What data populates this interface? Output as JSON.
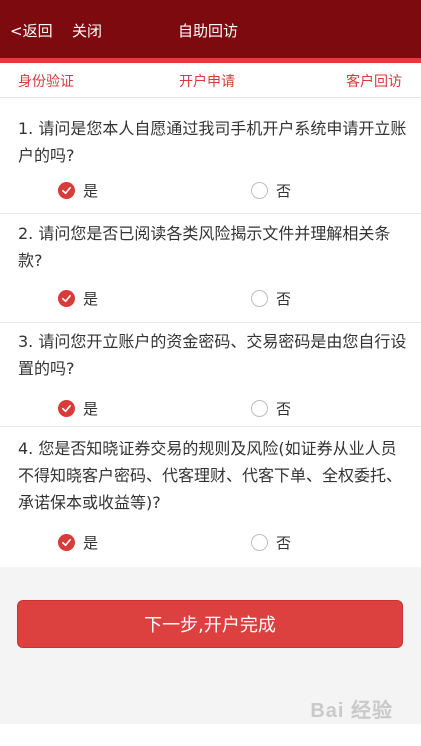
{
  "header": {
    "back_label": "<返回",
    "close_label": "关闭",
    "title": "自助回访",
    "bar_color": "#7d0a0f",
    "accent_line_color": "#e8373d"
  },
  "steps": {
    "items": [
      "身份验证",
      "开户申请",
      "客户回访"
    ]
  },
  "questions": [
    {
      "text": "1. 请问是您本人自愿通过我司手机开户系统申请开立账户的吗?",
      "yes_label": "是",
      "no_label": "否",
      "selected": "yes"
    },
    {
      "text": "2. 请问您是否已阅读各类风险揭示文件并理解相关条款?",
      "yes_label": "是",
      "no_label": "否",
      "selected": "yes"
    },
    {
      "text": "3. 请问您开立账户的资金密码、交易密码是由您自行设置的吗?",
      "yes_label": "是",
      "no_label": "否",
      "selected": "yes"
    },
    {
      "text": "4. 您是否知晓证券交易的规则及风险(如证券从业人员不得知晓客户密码、代客理财、代客下单、全权委托、承诺保本或收益等)?",
      "yes_label": "是",
      "no_label": "否",
      "selected": "yes"
    }
  ],
  "next_button": {
    "label": "下一步,开户完成",
    "color": "#dc4140"
  },
  "watermark": {
    "text": "Bai 经验",
    "icon": "baidu-paw-icon"
  }
}
